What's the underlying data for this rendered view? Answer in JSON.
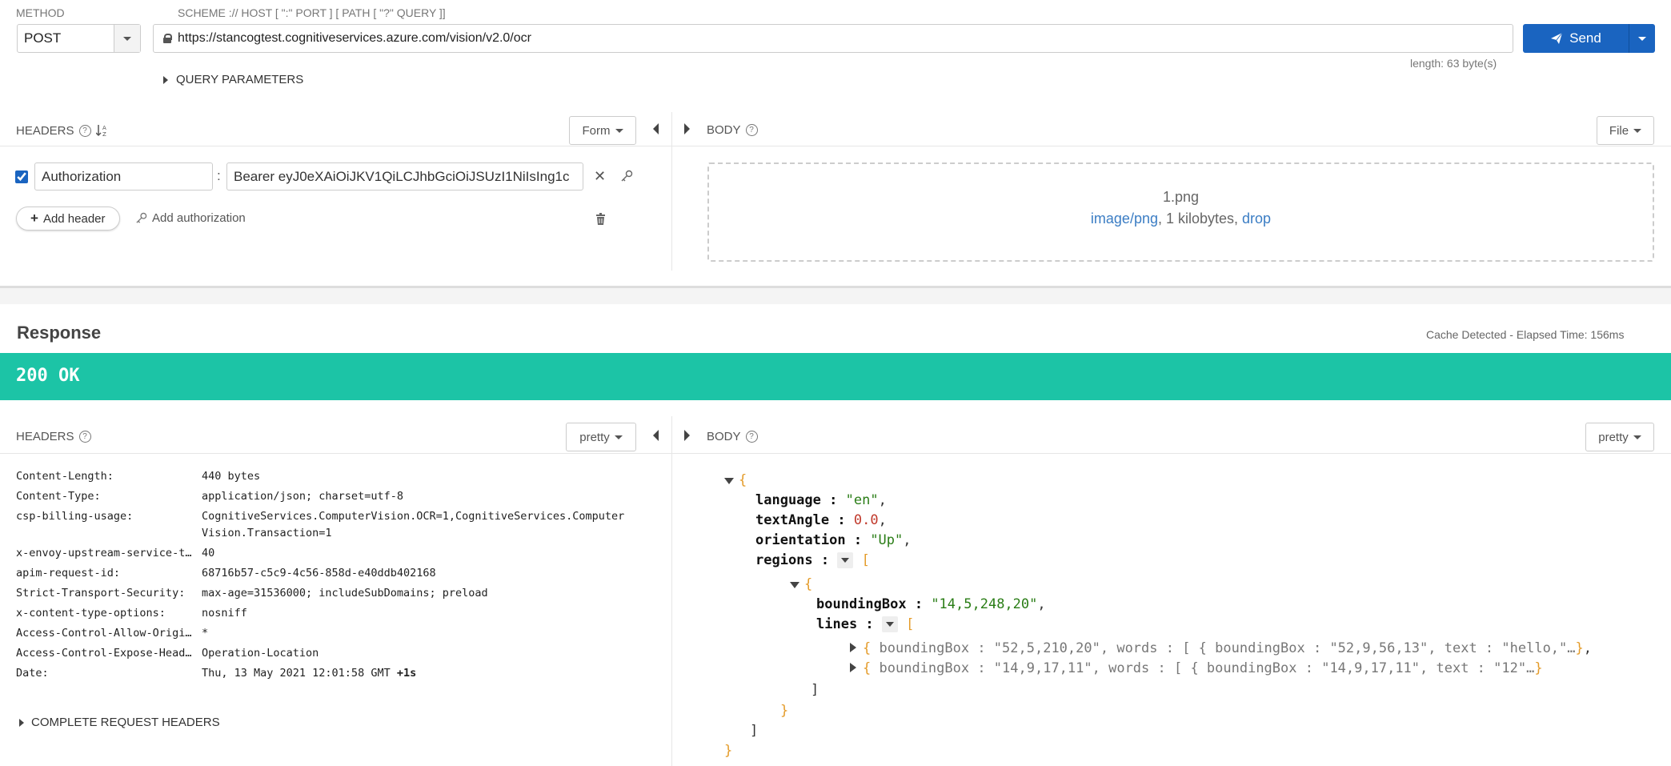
{
  "request": {
    "method_label": "METHOD",
    "method_value": "POST",
    "scheme_label": "SCHEME :// HOST [ \":\" PORT ] [ PATH [ \"?\" QUERY ]]",
    "url": "https://stancogtest.cognitiveservices.azure.com/vision/v2.0/ocr",
    "send_label": "Send",
    "length_text": "length: 63 byte(s)",
    "query_params_label": "QUERY PARAMETERS",
    "headers_label": "HEADERS",
    "headers_mode": "Form",
    "header_name": "Authorization",
    "header_value": "Bearer eyJ0eXAiOiJKV1QiLCJhbGciOiJSUzI1NiIsIng1c",
    "header_colon": ":",
    "add_header_label": "Add header",
    "add_auth_label": "Add authorization",
    "body_label": "BODY",
    "body_mode": "File",
    "file_name": "1.png",
    "file_type": "image/png",
    "file_size": ", 1 kilobytes, ",
    "file_drop": "drop"
  },
  "response": {
    "title": "Response",
    "cache_text": "Cache Detected - Elapsed Time: 156ms",
    "status": "200 OK",
    "headers_label": "HEADERS",
    "headers_mode": "pretty",
    "body_label": "BODY",
    "body_mode": "pretty",
    "complete_headers_label": "COMPLETE REQUEST HEADERS",
    "headers": [
      {
        "name": "Content-Length:",
        "value": "440 bytes"
      },
      {
        "name": "Content-Type:",
        "value": "application/json; charset=utf-8"
      },
      {
        "name": "csp-billing-usage:",
        "value": "CognitiveServices.ComputerVision.OCR=1,CognitiveServices.Computer",
        "value2": "Vision.Transaction=1"
      },
      {
        "name": "x-envoy-upstream-service-t…",
        "value": "40"
      },
      {
        "name": "apim-request-id:",
        "value": "68716b57-c5c9-4c56-858d-e40ddb402168"
      },
      {
        "name": "Strict-Transport-Security:",
        "value": "max-age=31536000; includeSubDomains; preload"
      },
      {
        "name": "x-content-type-options:",
        "value": "nosniff"
      },
      {
        "name": "Access-Control-Allow-Origi…",
        "value": "*"
      },
      {
        "name": "Access-Control-Expose-Head…",
        "value": "Operation-Location"
      },
      {
        "name": "Date:",
        "value": "Thu, 13 May 2021 12:01:58 GMT",
        "extra": "+1s"
      }
    ],
    "json": {
      "k_language": "language",
      "v_language": "\"en\"",
      "k_textAngle": "textAngle",
      "v_textAngle": "0.0",
      "k_orientation": "orientation",
      "v_orientation": "\"Up\"",
      "k_regions": "regions",
      "k_boundingBox": "boundingBox",
      "v_region_bbox": "\"14,5,248,20\"",
      "k_lines": "lines",
      "line1_bbox": "\"52,5,210,20\"",
      "line1_word_bbox": "\"52,9,56,13\"",
      "line1_text": "\"hello,\"",
      "line2_bbox": "\"14,9,17,11\"",
      "line2_word_bbox": "\"14,9,17,11\"",
      "line2_text": "\"12\""
    }
  },
  "colors": {
    "accent": "#1a64c0",
    "status_bg": "#1cc4a6",
    "link": "#3b7dc4"
  }
}
